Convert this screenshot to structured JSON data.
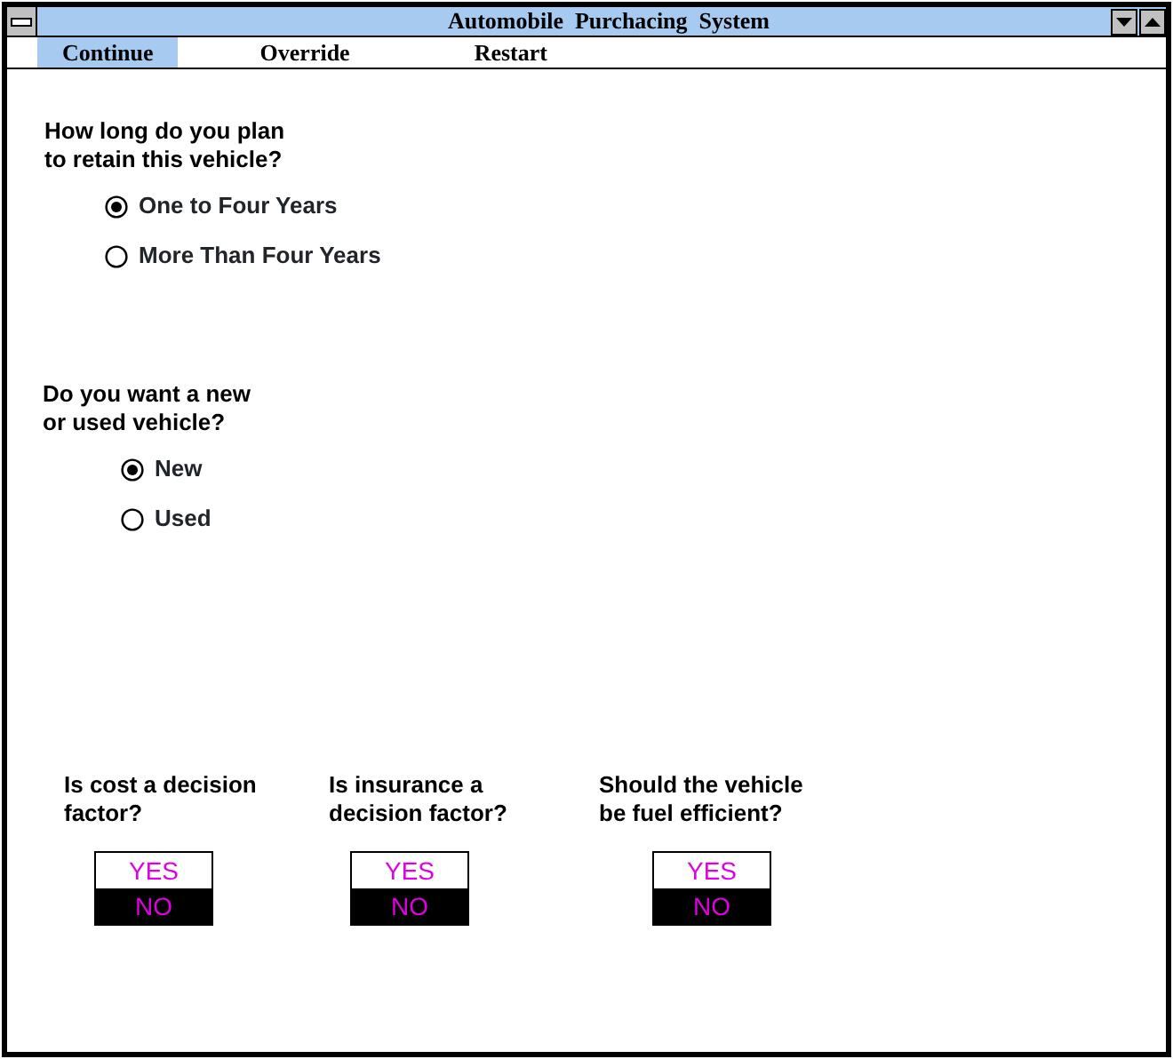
{
  "window": {
    "title": "Automobile  Purchacing  System"
  },
  "menu": [
    {
      "label": "Continue",
      "selected": true
    },
    {
      "label": "Override",
      "selected": false
    },
    {
      "label": "Restart",
      "selected": false
    }
  ],
  "radio_groups": [
    {
      "question": "How long do you plan\nto retain this vehicle?",
      "options": [
        {
          "label": "One to Four Years",
          "selected": true
        },
        {
          "label": "More Than Four Years",
          "selected": false
        }
      ]
    },
    {
      "question": "Do you want a new\nor used vehicle?",
      "options": [
        {
          "label": "New",
          "selected": true
        },
        {
          "label": "Used",
          "selected": false
        }
      ]
    }
  ],
  "toggles": [
    {
      "question": "Is cost a decision\nfactor?",
      "options": [
        {
          "label": "YES",
          "selected": false
        },
        {
          "label": "NO",
          "selected": true
        }
      ]
    },
    {
      "question": "Is insurance a\ndecision factor?",
      "options": [
        {
          "label": "YES",
          "selected": false
        },
        {
          "label": "NO",
          "selected": true
        }
      ]
    },
    {
      "question": "Should the vehicle\nbe fuel efficient?",
      "options": [
        {
          "label": "YES",
          "selected": false
        },
        {
          "label": "NO",
          "selected": true
        }
      ]
    }
  ]
}
